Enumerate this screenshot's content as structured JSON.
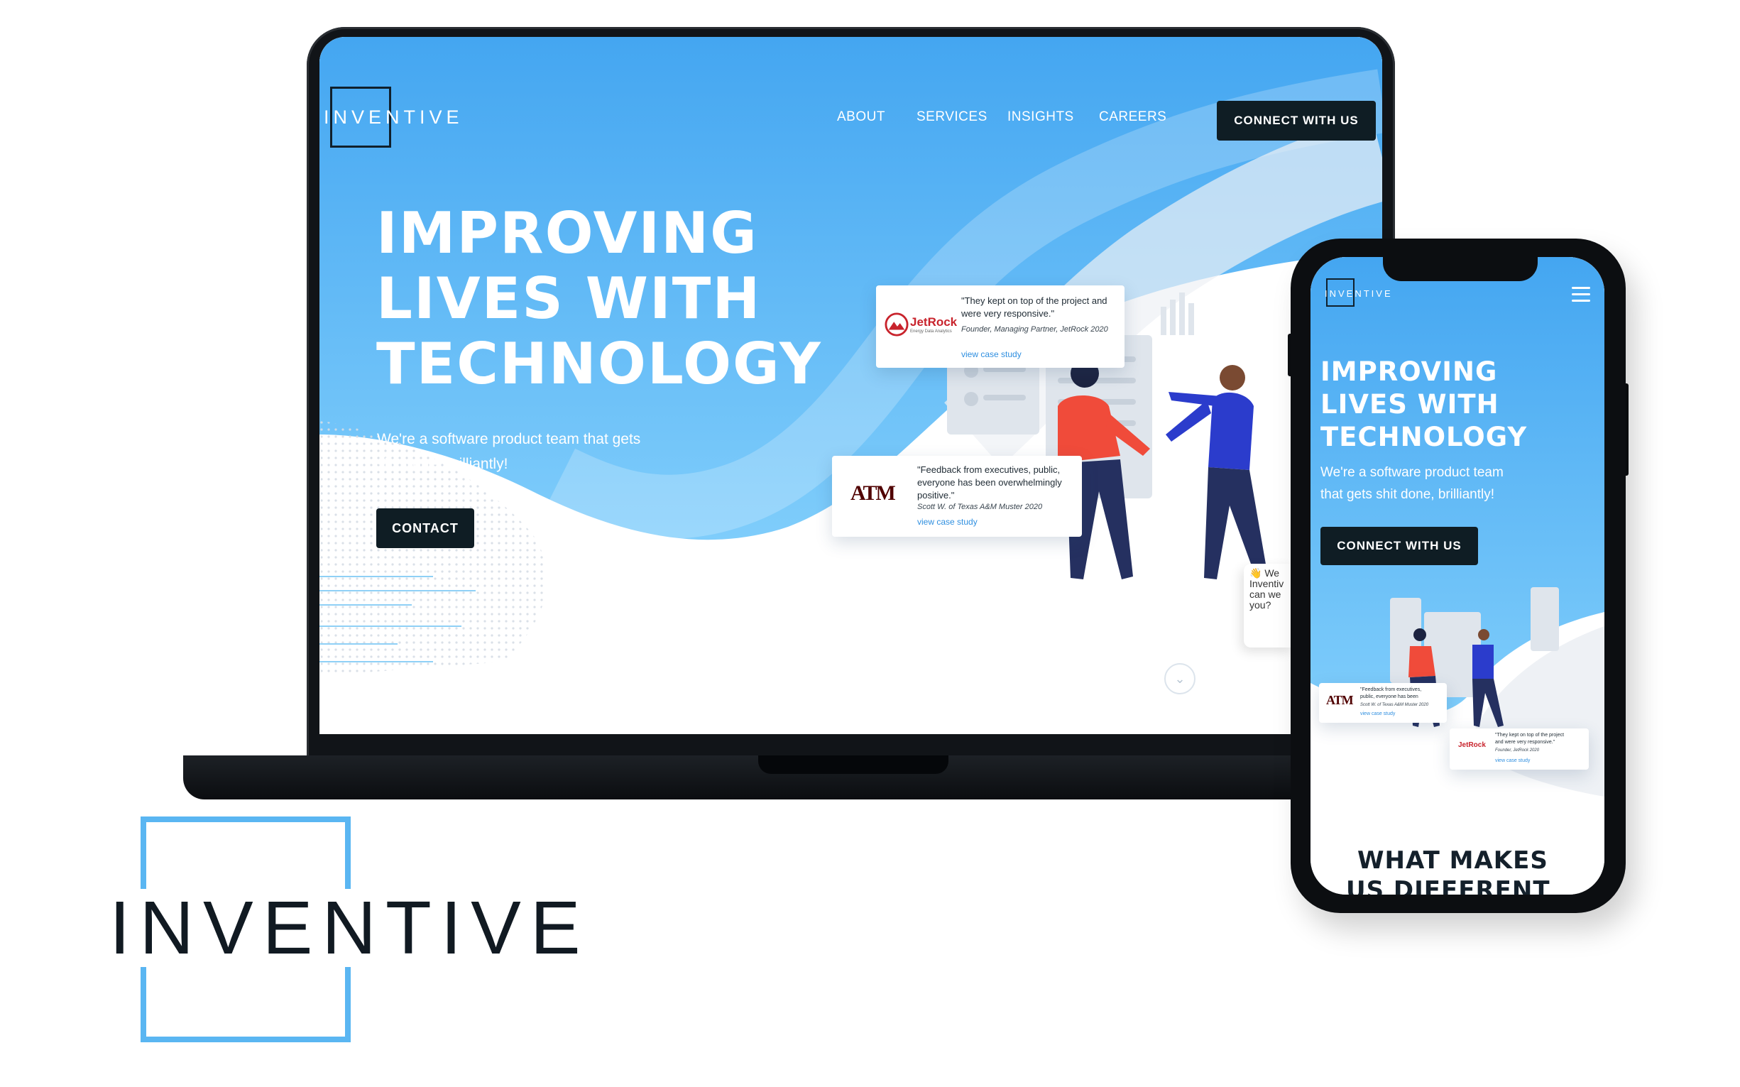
{
  "desktop": {
    "brand": "INVENTIVE",
    "nav": [
      "ABOUT",
      "SERVICES",
      "INSIGHTS",
      "CAREERS"
    ],
    "cta_label": "CONNECT WITH US",
    "hero_lines": [
      "IMPROVING",
      "LIVES WITH",
      "TECHNOLOGY"
    ],
    "subtitle_lines": [
      "We're a software product team that gets",
      "shit done, brilliantly!"
    ],
    "contact_label": "CONTACT",
    "testimonial_jetrock": {
      "logo": "JetRock",
      "logo_tagline": "Energy Data Analytics",
      "quote_lines": [
        "\"They kept on top of the project and",
        "were very responsive.\""
      ],
      "author": "Founder, Managing Partner, JetRock 2020",
      "link": "view case study"
    },
    "testimonial_tamu": {
      "logo": "ATM",
      "quote_lines": [
        "\"Feedback from executives, public,",
        "everyone has been overwhelmingly",
        "positive.\""
      ],
      "author": "Scott W. of Texas A&M Muster 2020",
      "link": "view case study"
    },
    "chat_text": "👋 We Inventiv can we you?"
  },
  "mobile": {
    "brand": "INVENTIVE",
    "hero_lines": [
      "IMPROVING",
      "LIVES WITH",
      "TECHNOLOGY"
    ],
    "subtitle_lines": [
      "We're a software product team",
      "that gets shit done, brilliantly!"
    ],
    "cta_label": "CONNECT WITH US",
    "testimonial_tamu": {
      "quote_lines": [
        "\"Feedback from executives,",
        "public, everyone has been"
      ],
      "author": "Scott W. of Texas A&M Muster 2020",
      "link": "view case study"
    },
    "testimonial_jetrock": {
      "quote_lines": [
        "\"They kept on top of the project",
        "and were very responsive.\""
      ],
      "author": "Founder, JetRock 2020",
      "link": "view case study"
    },
    "section_heading_lines": [
      "WHAT MAKES",
      "US DIFFERENT"
    ]
  },
  "logo_large": "INVENTIVE",
  "colors": {
    "sky_blue": "#4aaaf2",
    "navy": "#0f1d24",
    "logo_blue": "#5ab6f2",
    "figure_red": "#f04b3a",
    "figure_blue": "#2b3ccc",
    "link_blue": "#2f8fe0"
  }
}
